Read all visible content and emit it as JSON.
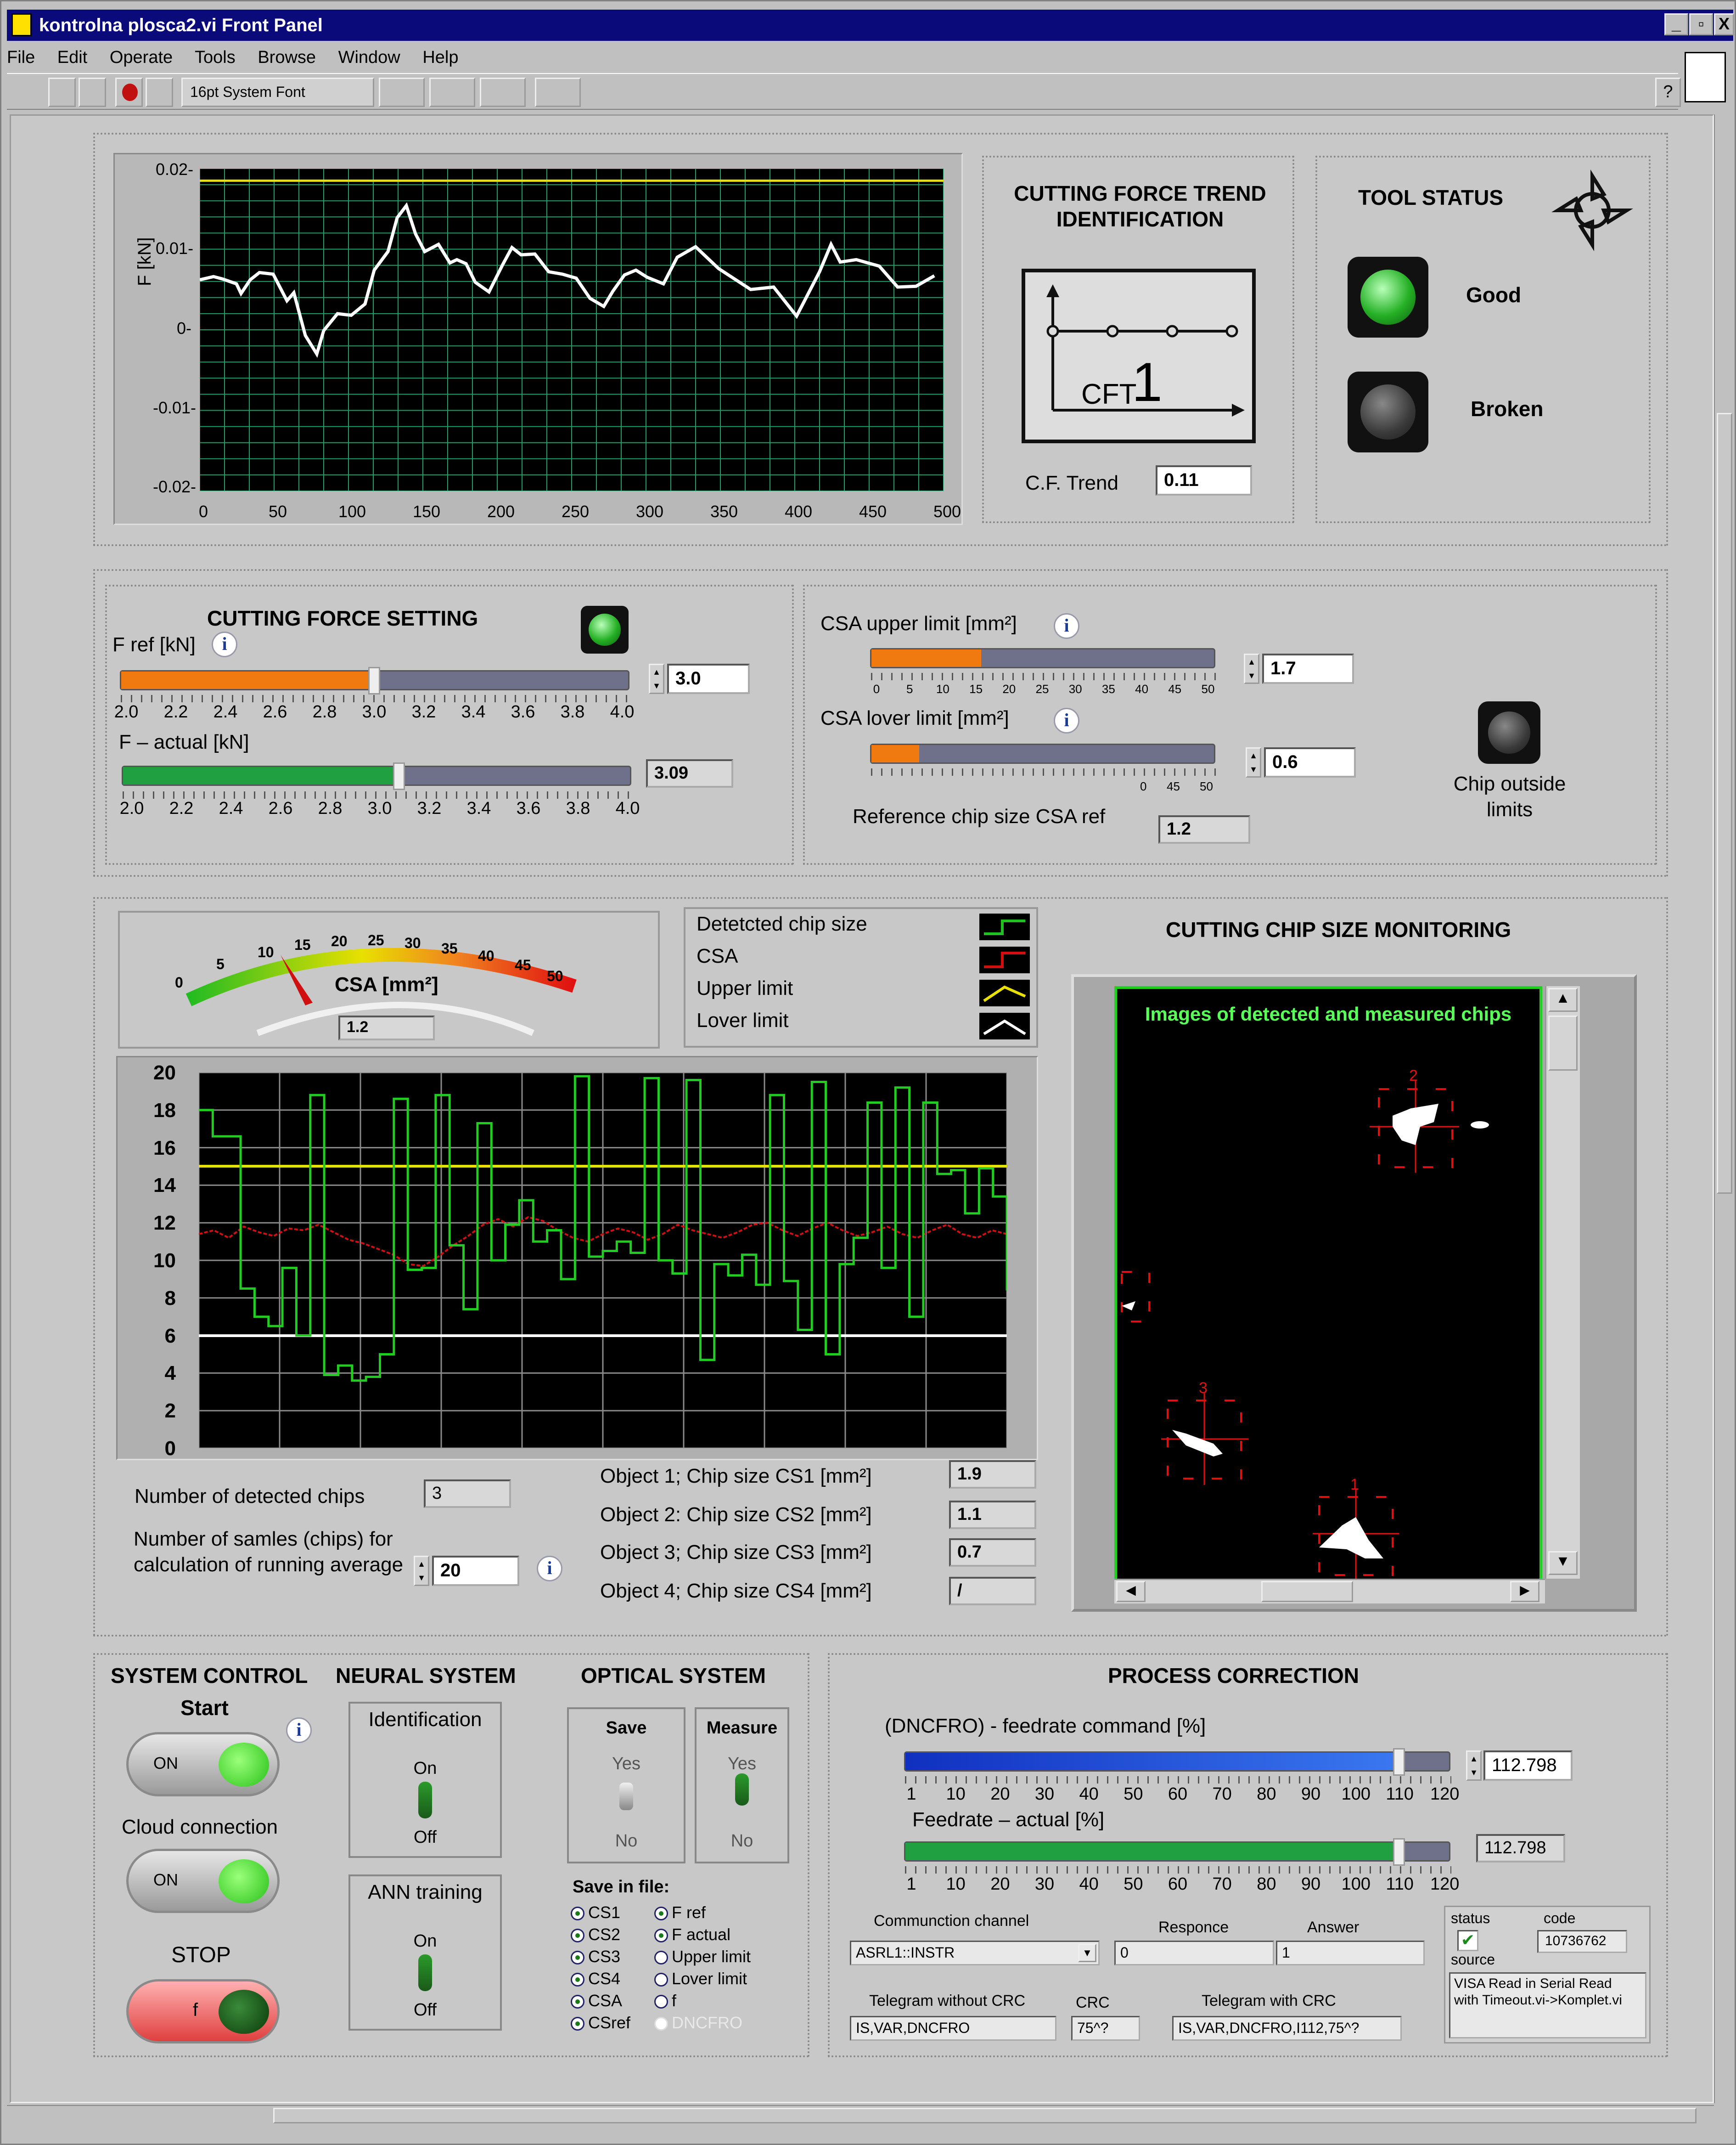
{
  "window": {
    "title": "kontrolna plosca2.vi Front Panel",
    "min": "_",
    "max": "▫",
    "close": "X"
  },
  "menu": [
    "File",
    "Edit",
    "Operate",
    "Tools",
    "Browse",
    "Window",
    "Help"
  ],
  "toolbar": {
    "font_label": "16pt System Font"
  },
  "top_graph": {
    "ylabel": "F [kN]",
    "yticks": [
      "0.02-",
      "0.01-",
      "0-",
      "-0.01-",
      "-0.02-"
    ],
    "xticks": [
      "0",
      "50",
      "100",
      "150",
      "200",
      "250",
      "300",
      "350",
      "400",
      "450",
      "500"
    ],
    "reference_line": 0.0185,
    "colors": {
      "bg": "#000000",
      "grid": "#1fa06a",
      "signal": "#ffffff",
      "ref": "#e8e000"
    }
  },
  "trend": {
    "title": "CUTTING FORCE TREND IDENTIFICATION",
    "glyph_text": "CFT",
    "glyph_number": "1",
    "value_label": "C.F. Trend",
    "value": "0.11"
  },
  "tool_status": {
    "title": "TOOL STATUS",
    "good": "Good",
    "broken": "Broken"
  },
  "force_setting": {
    "title": "CUTTING FORCE  SETTING",
    "fref_label": "F ref [kN]",
    "fref": "3.0",
    "fref_level": 3.0,
    "scale": [
      "2.0",
      "2.2",
      "2.4",
      "2.6",
      "2.8",
      "3.0",
      "3.2",
      "3.4",
      "3.6",
      "3.8",
      "4.0"
    ],
    "fact_label": "F – actual [kN]",
    "fact": "3.09",
    "fact_level": 3.09
  },
  "csa": {
    "upper_label": "CSA upper limit [mm²]",
    "upper": "1.7",
    "upper_scale": [
      "0",
      "5",
      "10",
      "15",
      "20",
      "25",
      "30",
      "35",
      "40",
      "45",
      "50"
    ],
    "lower_label": "CSA lover limit [mm²]",
    "lower": "0.6",
    "lower_scale": [
      "0",
      "45",
      "50"
    ],
    "ref_label": "Reference chip size CSA ref",
    "ref": "1.2",
    "chip_outside": "Chip outside limits"
  },
  "gauge": {
    "label": "CSA [mm²]",
    "value": "1.2",
    "ticks": [
      "0",
      "5",
      "10",
      "15",
      "20",
      "25",
      "30",
      "35",
      "40",
      "45",
      "50"
    ]
  },
  "legend": [
    {
      "name": "Detetcted chip size",
      "color": "#20c020"
    },
    {
      "name": "CSA",
      "color": "#d01010"
    },
    {
      "name": "Upper limit",
      "color": "#e8e000"
    },
    {
      "name": "Lover limit",
      "color": "#ffffff"
    }
  ],
  "chip_chart": {
    "yticks": [
      "20",
      "18",
      "16",
      "14",
      "12",
      "10",
      "8",
      "6",
      "4",
      "2",
      "0"
    ]
  },
  "chip_monitor": {
    "title": "CUTTING CHIP SIZE MONITORING",
    "image_caption": "Images of detected and measured chips",
    "markers": [
      "2",
      "3",
      "1"
    ]
  },
  "detected": {
    "label": "Number of detected chips",
    "value": "3",
    "samples_label": "Number of samles (chips) for calculation of running average",
    "samples": "20"
  },
  "objects": [
    {
      "label": "Object 1; Chip size CS1 [mm²]",
      "value": "1.9"
    },
    {
      "label": "Object 2: Chip size CS2 [mm²]",
      "value": "1.1"
    },
    {
      "label": "Object 3; Chip size CS3 [mm²]",
      "value": "0.7"
    },
    {
      "label": "Object 4; Chip size CS4 [mm²]",
      "value": "/"
    }
  ],
  "system": {
    "title": "SYSTEM CONTROL",
    "start": "Start",
    "on": "ON",
    "cloud": "Cloud connection",
    "stop": "STOP",
    "stop_glyph": "f"
  },
  "neural": {
    "title": "NEURAL SYSTEM",
    "ident": "Identification",
    "on": "On",
    "off": "Off",
    "ann": "ANN training"
  },
  "optical": {
    "title": "OPTICAL SYSTEM",
    "save": "Save",
    "measure": "Measure",
    "yes": "Yes",
    "no": "No",
    "save_file": "Save in file:",
    "col1": [
      "CS1",
      "CS2",
      "CS3",
      "CS4",
      "CSA",
      "CSref"
    ],
    "col2": [
      "F ref",
      "F actual",
      "Upper limit",
      "Lover limit",
      "f",
      "DNCFRO"
    ]
  },
  "process": {
    "title": "PROCESS CORRECTION",
    "feed_cmd_label": "(DNCFRO) - feedrate command [%]",
    "feed_cmd": "112.798",
    "feed_cmd_level": 112.798,
    "feed_act_label": "Feedrate – actual [%]",
    "feed_act": "112.798",
    "feed_act_level": 112.798,
    "scale": [
      "1",
      "10",
      "20",
      "30",
      "40",
      "50",
      "60",
      "70",
      "80",
      "90",
      "100",
      "110",
      "120"
    ],
    "comm_label": "Communction channel",
    "comm": "ASRL1::INSTR",
    "resp_label": "Responce",
    "resp": "0",
    "ans_label": "Answer",
    "ans": "1",
    "status_label": "status",
    "code_label": "code",
    "code": "10736762",
    "source_label": "source",
    "source": "VISA Read in Serial Read with Timeout.vi->Komplet.vi",
    "tel_label": "Telegram without CRC",
    "tel": "IS,VAR,DNCFRO",
    "crc_label": "CRC",
    "crc": "75^?",
    "telcrc_label": "Telegram with CRC",
    "telcrc": "IS,VAR,DNCFRO,I112,75^?"
  }
}
